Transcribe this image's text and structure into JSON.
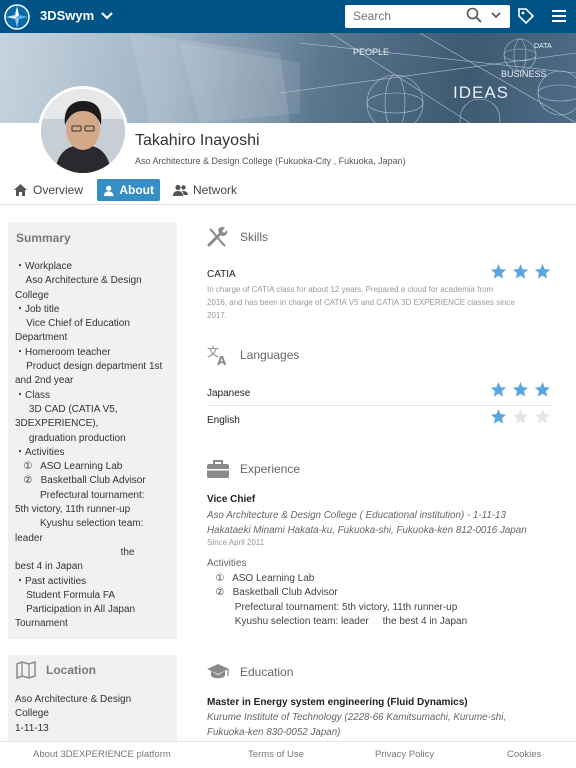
{
  "topbar": {
    "brand": "3DSwym",
    "search_placeholder": "Search",
    "icons": [
      "compass-icon",
      "chevron-down-icon",
      "search-icon",
      "tag-icon",
      "menu-icon"
    ]
  },
  "banner": {
    "words": [
      "PEOPLE",
      "DATA",
      "BUSINESS",
      "IDEAS"
    ]
  },
  "profile": {
    "name": "Takahiro Inayoshi",
    "affiliation": "Aso Architecture & Design College (Fukuoka-City , Fukuoka, Japan)"
  },
  "tabs": [
    {
      "label": "Overview",
      "icon": "home-icon"
    },
    {
      "label": "About",
      "icon": "user-icon",
      "active": true
    },
    {
      "label": "Network",
      "icon": "users-icon"
    }
  ],
  "summary": {
    "title": "Summary",
    "lines": [
      "・Workplace",
      "    Aso Architecture & Design",
      "College",
      "・Job title",
      "    Vice Chief of Education",
      "Department",
      "・Homeroom teacher",
      "    Product design department 1st",
      "and 2nd year",
      "・Class",
      "     3D CAD (CATIA V5,",
      "3DEXPERIENCE),",
      "     graduation production",
      "・Activities",
      "   ①   ASO Learning Lab",
      "   ②   Basketball Club Advisor",
      "         Prefectural tournament:",
      "5th victory, 11th runner-up",
      "         Kyushu selection team:",
      "leader",
      "                                      the",
      "best 4 in Japan",
      "・Past activities",
      "    Student Formula FA",
      "    Participation in All Japan",
      "Tournament"
    ]
  },
  "location": {
    "title": "Location",
    "lines": [
      "Aso Architecture & Design",
      "College",
      "1-11-13"
    ]
  },
  "skills": {
    "title": "Skills",
    "items": [
      {
        "name": "CATIA",
        "desc_1": "In charge of CATIA class for about 12 years. Prepared a cloud for academia from",
        "desc_2": "2016, and has been in charge of CATIA V5 and CATIA 3D EXPERIENCE classes since",
        "desc_3": "2017.",
        "rating": 3
      }
    ]
  },
  "languages": {
    "title": "Languages",
    "items": [
      {
        "name": "Japanese",
        "rating": 3
      },
      {
        "name": "English",
        "rating": 1
      }
    ]
  },
  "experience": {
    "title": "Experience",
    "role": "Vice Chief",
    "org_1": "Aso Architecture & Design College ( Educational institution) - 1-11-13",
    "org_2": "Hakataeki Minami Hakata-ku, Fukuoka-shi, Fukuoka-ken 812-0016 Japan",
    "since": "Since April 2011",
    "activities_label": "Activities",
    "activities": [
      "   ①   ASO Learning Lab",
      "   ②   Basketball Club Advisor",
      "          Prefectural tournament: 5th victory, 11th runner-up",
      "          Kyushu selection team: leader     the best 4 in Japan"
    ]
  },
  "education": {
    "title": "Education",
    "degree": "Master in Energy system engineering  (Fluid Dynamics)",
    "school_1": "Kurume Institute of Technology (2228-66 Kamitsumachi, Kurume-shi,",
    "school_2": "Fukuoka-ken 830-0052 Japan)"
  },
  "footer": {
    "links": [
      "About 3DEXPERIENCE platform",
      "Terms of Use",
      "Privacy Policy",
      "Cookies"
    ]
  },
  "colors": {
    "topbar": "#005386",
    "accent": "#368ec4",
    "star_on": "#5aa7e0",
    "star_off": "#e6e6e6"
  }
}
